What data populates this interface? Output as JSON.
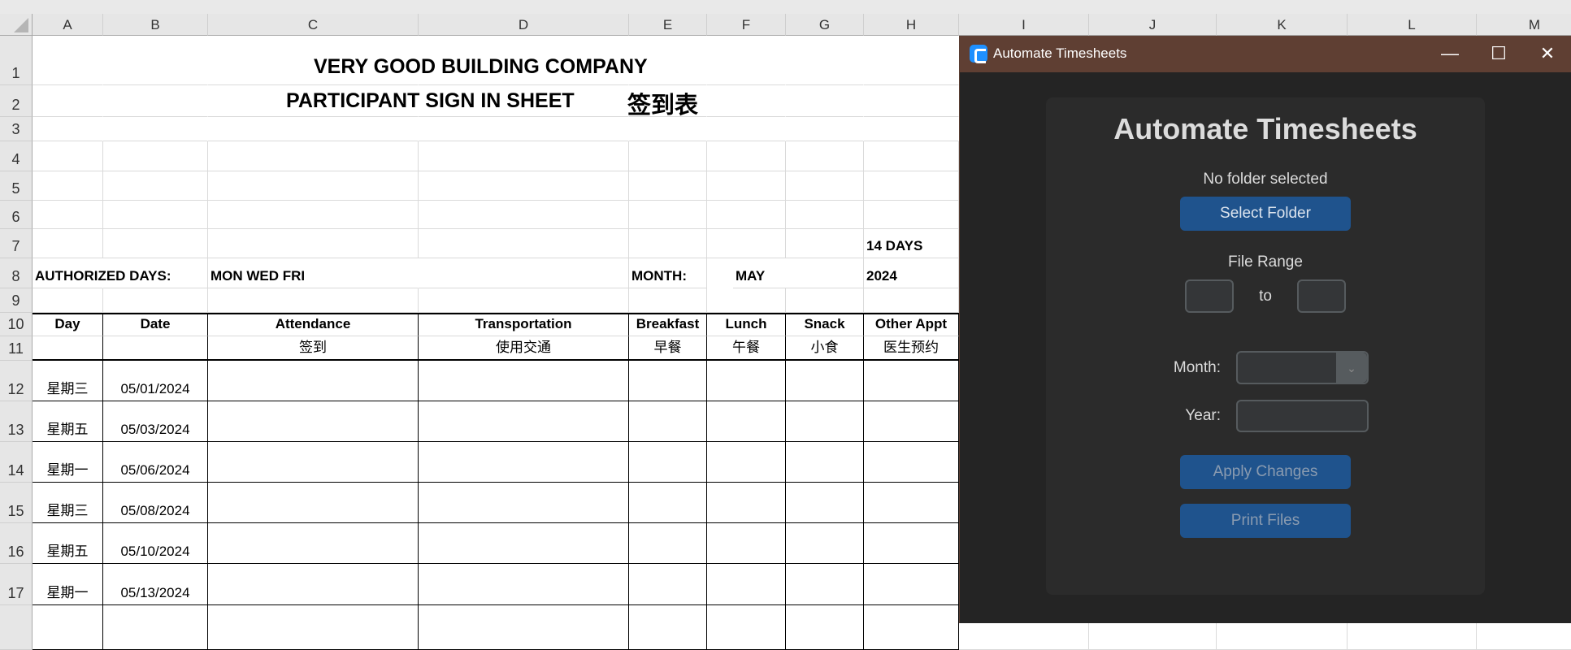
{
  "spreadsheet": {
    "columns": [
      "A",
      "B",
      "C",
      "D",
      "E",
      "F",
      "G",
      "H",
      "I",
      "J",
      "K",
      "L",
      "M"
    ],
    "rows": [
      "1",
      "2",
      "3",
      "4",
      "5",
      "6",
      "7",
      "8",
      "9",
      "10",
      "11",
      "12",
      "13",
      "14",
      "15",
      "16",
      "17"
    ],
    "title1": "VERY GOOD BUILDING COMPANY",
    "title2": "PARTICIPANT SIGN IN SHEET",
    "title2_cn": "签到表",
    "days_count": "14 DAYS",
    "authorized_label": "AUTHORIZED DAYS:",
    "authorized_days": "MON    WED    FRI",
    "month_label": "MONTH:",
    "month": "MAY",
    "year": "2024",
    "headers": [
      "Day",
      "Date",
      "Attendance",
      "Transportation",
      "Breakfast",
      "Lunch",
      "Snack",
      "Other Appt"
    ],
    "headers_cn": [
      "",
      "",
      "签到",
      "使用交通",
      "早餐",
      "午餐",
      "小食",
      "医生预约"
    ],
    "entries": [
      {
        "day": "星期三",
        "date": "05/01/2024"
      },
      {
        "day": "星期五",
        "date": "05/03/2024"
      },
      {
        "day": "星期一",
        "date": "05/06/2024"
      },
      {
        "day": "星期三",
        "date": "05/08/2024"
      },
      {
        "day": "星期五",
        "date": "05/10/2024"
      },
      {
        "day": "星期一",
        "date": "05/13/2024"
      }
    ]
  },
  "window": {
    "title": "Automate Timesheets",
    "heading": "Automate Timesheets",
    "folder_status": "No folder selected",
    "select_folder": "Select Folder",
    "file_range_label": "File Range",
    "to_label": "to",
    "range_from": "",
    "range_to": "",
    "month_label": "Month:",
    "month_value": "",
    "year_label": "Year:",
    "year_value": "",
    "apply": "Apply Changes",
    "print": "Print Files",
    "minimize": "—",
    "maximize": "☐",
    "close": "✕"
  }
}
